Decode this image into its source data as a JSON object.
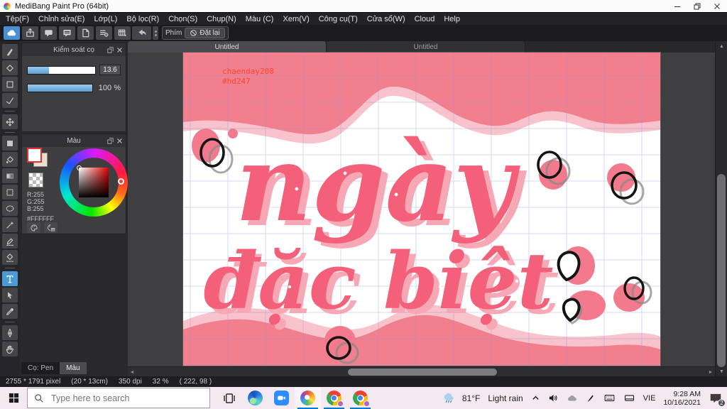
{
  "window": {
    "title": "MediBang Paint Pro (64bit)"
  },
  "menubar": {
    "items": [
      "Tệp(F)",
      "Chỉnh sửa(E)",
      "Lớp(L)",
      "Bộ lọc(R)",
      "Chọn(S)",
      "Chụp(N)",
      "Màu (C)",
      "Xem(V)",
      "Công cụ(T)",
      "Cửa sổ(W)",
      "Cloud",
      "Help"
    ]
  },
  "quickbar": {
    "icons": [
      "cloud",
      "export",
      "chat-round",
      "chat-square",
      "document",
      "list-settings",
      "grid-edit"
    ],
    "active_icon": "cloud",
    "phim_label": "Phím",
    "reset_label": "Đặt lại"
  },
  "tools": {
    "items": [
      "brush",
      "eraser",
      "figure",
      "polyline",
      "|",
      "move",
      "|",
      "fill-rect",
      "bucket",
      "gradient",
      "select-rect",
      "lasso",
      "magic-wand",
      "select-pen",
      "select-eraser",
      "|",
      "text",
      "operation",
      "eyedropper",
      "|",
      "div-pen",
      "hand"
    ],
    "active": "text"
  },
  "brush_panel": {
    "title": "Kiểm soát cọ",
    "size_value": "13.6",
    "size_fill_pct": 32,
    "opacity_value": "100 %",
    "opacity_fill_pct": 100
  },
  "color_panel": {
    "title": "Màu",
    "r": "R:255",
    "g": "G:255",
    "b": "B:255",
    "hex": "#FFFFFF"
  },
  "panel_tabs": {
    "brush": "Cọ: Pen",
    "color": "Màu"
  },
  "document": {
    "tabs": [
      "Untitled",
      "Untitled"
    ],
    "signature": [
      "chaenday208",
      "#hd247"
    ],
    "words": [
      "ngày",
      "đặc biệt"
    ],
    "colors": {
      "wave": "#f27f8e",
      "wave_light": "#f8c3cc",
      "lettering": "#f4607a",
      "lettering_shadow": "#f6a9b4",
      "grid": "#8f93d6",
      "signature": "#fb472e",
      "blob": "#f3798c"
    }
  },
  "statusbar": {
    "segments": [
      "2755 * 1791 pixel",
      "(20 * 13cm)",
      "350 dpi",
      "32 %",
      "( 222, 98 )"
    ]
  },
  "taskbar": {
    "search_placeholder": "Type here to search",
    "weather": {
      "temp": "81°F",
      "desc": "Light rain"
    },
    "language": "VIE",
    "clock": {
      "time": "9:28 AM",
      "date": "10/16/2021"
    },
    "notifications": "2"
  }
}
